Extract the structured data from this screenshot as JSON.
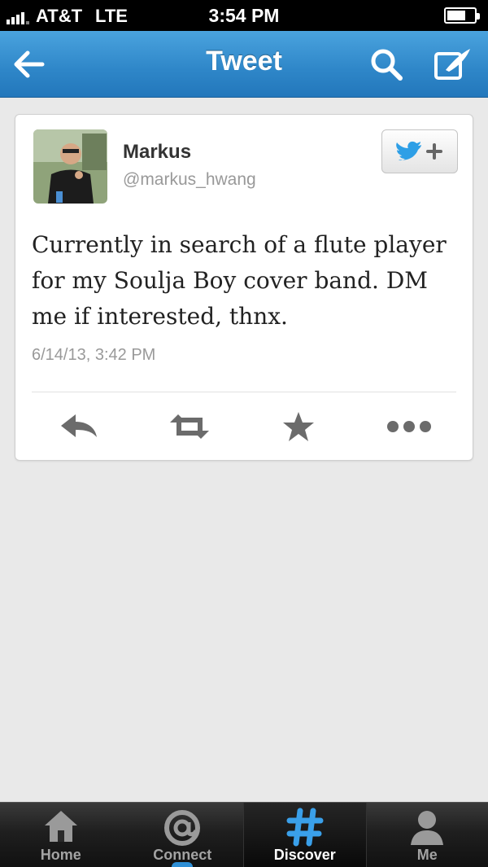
{
  "status_bar": {
    "carrier": "AT&T",
    "network": "LTE",
    "time": "3:54 PM"
  },
  "nav": {
    "title": "Tweet",
    "back_icon": "back-arrow-icon",
    "search_icon": "search-icon",
    "compose_icon": "compose-icon"
  },
  "tweet": {
    "author_name": "Markus",
    "author_handle": "@markus_hwang",
    "text": "Currently in search of a flute player for my Soulja Boy cover band. DM me if interested, thnx.",
    "timestamp": "6/14/13, 3:42 PM",
    "follow_icon": "follow-bird-icon",
    "actions": [
      "reply-icon",
      "retweet-icon",
      "favorite-icon",
      "more-icon"
    ]
  },
  "tabs": [
    {
      "label": "Home",
      "icon": "home-icon",
      "active": false
    },
    {
      "label": "Connect",
      "icon": "at-icon",
      "active": false
    },
    {
      "label": "Discover",
      "icon": "hash-icon",
      "active": true
    },
    {
      "label": "Me",
      "icon": "person-icon",
      "active": false
    }
  ],
  "colors": {
    "nav_blue": "#2e86c8",
    "twitter_blue": "#2e9fe6",
    "discover_active": "#ffffff"
  }
}
